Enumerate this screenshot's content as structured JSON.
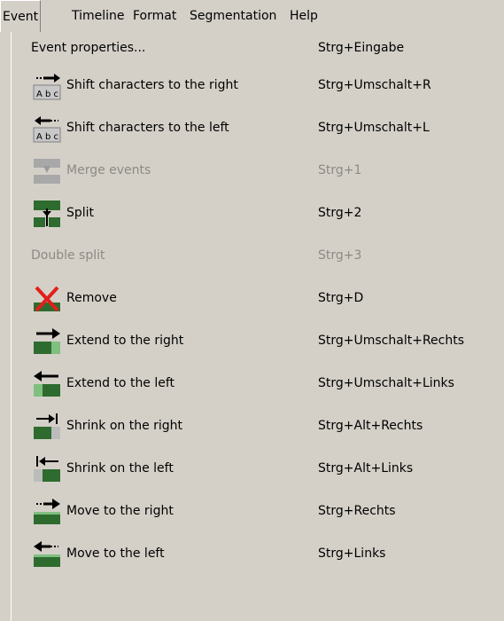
{
  "menubar": {
    "items": [
      "Event",
      "Timeline",
      "Format",
      "Segmentation",
      "Help"
    ],
    "active": "Event"
  },
  "menu": {
    "items": [
      {
        "label": "Event properties...",
        "shortcut": "Strg+Eingabe",
        "icon": null,
        "enabled": true
      },
      {
        "label": "Shift characters to the right",
        "shortcut": "Strg+Umschalt+R",
        "icon": "shift-chars-right-icon",
        "enabled": true
      },
      {
        "label": "Shift characters to the left",
        "shortcut": "Strg+Umschalt+L",
        "icon": "shift-chars-left-icon",
        "enabled": true
      },
      {
        "label": "Merge events",
        "shortcut": "Strg+1",
        "icon": "merge-events-icon",
        "enabled": false
      },
      {
        "label": "Split",
        "shortcut": "Strg+2",
        "icon": "split-icon",
        "enabled": true
      },
      {
        "label": "Double split",
        "shortcut": "Strg+3",
        "icon": null,
        "enabled": false
      },
      {
        "label": "Remove",
        "shortcut": "Strg+D",
        "icon": "remove-icon",
        "enabled": true
      },
      {
        "label": "Extend to the right",
        "shortcut": "Strg+Umschalt+Rechts",
        "icon": "extend-right-icon",
        "enabled": true
      },
      {
        "label": "Extend to the left",
        "shortcut": "Strg+Umschalt+Links",
        "icon": "extend-left-icon",
        "enabled": true
      },
      {
        "label": "Shrink on the right",
        "shortcut": "Strg+Alt+Rechts",
        "icon": "shrink-right-icon",
        "enabled": true
      },
      {
        "label": "Shrink on the left",
        "shortcut": "Strg+Alt+Links",
        "icon": "shrink-left-icon",
        "enabled": true
      },
      {
        "label": "Move to the right",
        "shortcut": "Strg+Rechts",
        "icon": "move-right-icon",
        "enabled": true
      },
      {
        "label": "Move to the left",
        "shortcut": "Strg+Links",
        "icon": "move-left-icon",
        "enabled": true
      }
    ]
  },
  "colors": {
    "background": "#d4d0c8",
    "event_bar": "#2e6b2e",
    "disabled_text": "#8c8a85",
    "remove_cross": "#e0201c"
  }
}
